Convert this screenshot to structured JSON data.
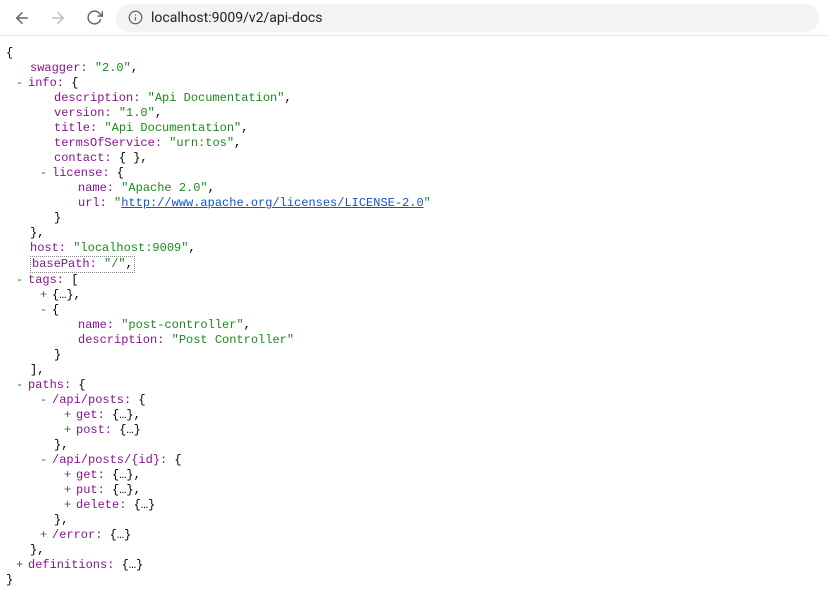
{
  "browser": {
    "url": "localhost:9009/v2/api-docs"
  },
  "json": {
    "swagger_key": "swagger:",
    "swagger_val": "\"2.0\"",
    "info_key": "info:",
    "description_key": "description:",
    "description_val": "\"Api Documentation\"",
    "version_key": "version:",
    "version_val": "\"1.0\"",
    "title_key": "title:",
    "title_val": "\"Api Documentation\"",
    "tos_key": "termsOfService:",
    "tos_val": "\"urn:tos\"",
    "contact_key": "contact:",
    "contact_val": "{ }",
    "license_key": "license:",
    "name_key": "name:",
    "license_name_val": "\"Apache 2.0\"",
    "url_key": "url:",
    "license_url_val": "http://www.apache.org/licenses/LICENSE-2.0",
    "host_key": "host:",
    "host_val": "\"localhost:9009\"",
    "basepath_key": "basePath:",
    "basepath_val": "\"/\"",
    "tags_key": "tags:",
    "collapsed_obj": "{…}",
    "tag_name_val": "\"post-controller\"",
    "tag_desc_val": "\"Post Controller\"",
    "paths_key": "paths:",
    "path_posts_key": "/api/posts:",
    "get_key": "get:",
    "post_key": "post:",
    "path_posts_id_key": "/api/posts/{id}:",
    "put_key": "put:",
    "delete_key": "delete:",
    "error_key": "/error:",
    "definitions_key": "definitions:"
  },
  "toggles": {
    "minus": "-",
    "plus": "+"
  },
  "brackets": {
    "open_curly": " {",
    "close_curly": "}",
    "open_square": " [",
    "close_square": "]",
    "curly_lone": "{",
    "comma": ","
  }
}
